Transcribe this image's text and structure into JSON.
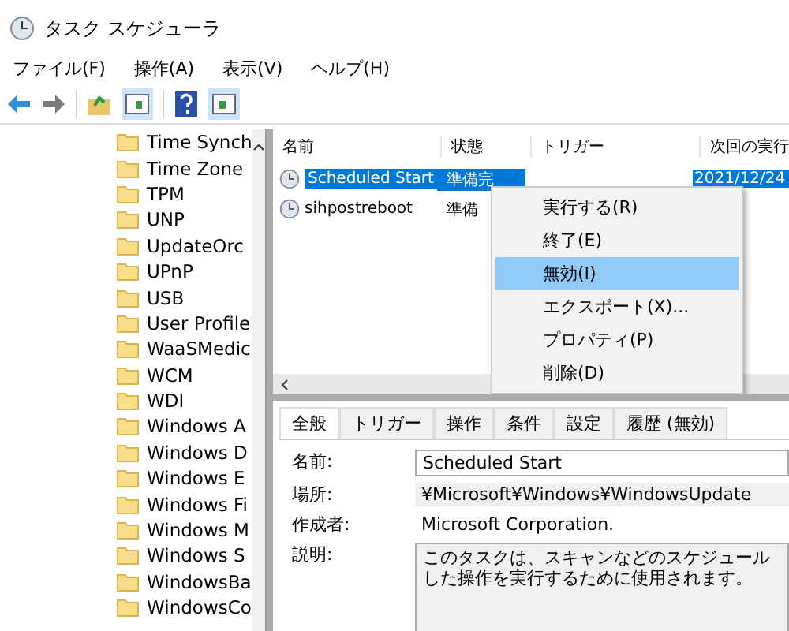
{
  "window": {
    "title": "タスク スケジューラ"
  },
  "menu_bar": [
    "ファイル(F)",
    "操作(A)",
    "表示(V)",
    "ヘルプ(H)"
  ],
  "tree": {
    "items": [
      {
        "label": "Time Synch"
      },
      {
        "label": "Time Zone"
      },
      {
        "label": "TPM"
      },
      {
        "label": "UNP"
      },
      {
        "label": "UpdateOrc"
      },
      {
        "label": "UPnP"
      },
      {
        "label": "USB"
      },
      {
        "label": "User Profile"
      },
      {
        "label": "WaaSMedic"
      },
      {
        "label": "WCM"
      },
      {
        "label": "WDI"
      },
      {
        "label": "Windows A"
      },
      {
        "label": "Windows D"
      },
      {
        "label": "Windows E"
      },
      {
        "label": "Windows Fi"
      },
      {
        "label": "Windows M"
      },
      {
        "label": "Windows S"
      },
      {
        "label": "WindowsBa"
      },
      {
        "label": "WindowsCo"
      }
    ]
  },
  "task_list": {
    "columns": [
      "名前",
      "状態",
      "トリガー",
      "次回の実行"
    ],
    "rows": [
      {
        "name": "Scheduled Start",
        "state": "準備完",
        "trigger": "",
        "next_run": "2021/12/24",
        "selected": true
      },
      {
        "name": "sihpostreboot",
        "state": "準備",
        "trigger": "",
        "next_run": "",
        "selected": false
      }
    ]
  },
  "context_menu": [
    {
      "label": "実行する(R)",
      "selected": false
    },
    {
      "label": "終了(E)",
      "selected": false
    },
    {
      "label": "無効(I)",
      "selected": true
    },
    {
      "label": "エクスポート(X)...",
      "selected": false
    },
    {
      "label": "プロパティ(P)",
      "selected": false
    },
    {
      "label": "削除(D)",
      "selected": false
    }
  ],
  "details": {
    "tabs": [
      {
        "label": "全般",
        "selected": true
      },
      {
        "label": "トリガー",
        "selected": false
      },
      {
        "label": "操作",
        "selected": false
      },
      {
        "label": "条件",
        "selected": false
      },
      {
        "label": "設定",
        "selected": false
      },
      {
        "label": "履歴 (無効)",
        "selected": false
      }
    ],
    "name_label": "名前:",
    "name_value": "Scheduled Start",
    "location_label": "場所:",
    "location_value": "¥Microsoft¥Windows¥WindowsUpdate",
    "author_label": "作成者:",
    "author_value": "Microsoft Corporation.",
    "description_label": "説明:",
    "description_value": "このタスクは、スキャンなどのスケジュールした操作を実行するために使用されます。"
  }
}
